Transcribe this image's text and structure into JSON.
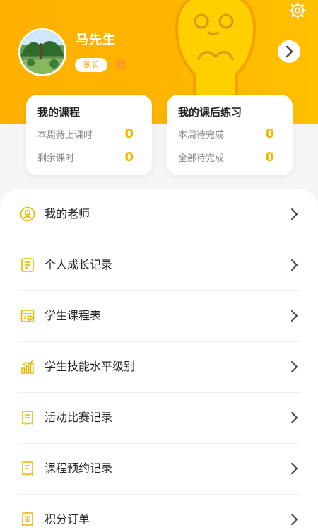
{
  "profile": {
    "name": "马先生",
    "role": "家长"
  },
  "icons": {
    "settings": "gear-icon",
    "profile_arrow": "chevron-right-icon"
  },
  "colors": {
    "accent": "#ffb300",
    "value": "#f2b800",
    "icon": "#e6b800"
  },
  "cards": [
    {
      "title": "我的课程",
      "rows": [
        {
          "label": "本周待上课时",
          "value": "0"
        },
        {
          "label": "剩余课时",
          "value": "0"
        }
      ]
    },
    {
      "title": "我的课后练习",
      "rows": [
        {
          "label": "本周待完成",
          "value": "0"
        },
        {
          "label": "全部待完成",
          "value": "0"
        }
      ]
    }
  ],
  "menu": [
    {
      "label": "我的老师",
      "icon": "teacher-icon"
    },
    {
      "label": "个人成长记录",
      "icon": "record-icon"
    },
    {
      "label": "学生课程表",
      "icon": "schedule-icon"
    },
    {
      "label": "学生技能水平级别",
      "icon": "chart-icon"
    },
    {
      "label": "活动比赛记录",
      "icon": "competition-icon"
    },
    {
      "label": "课程预约记录",
      "icon": "appointment-icon"
    },
    {
      "label": "积分订单",
      "icon": "points-order-icon"
    }
  ]
}
